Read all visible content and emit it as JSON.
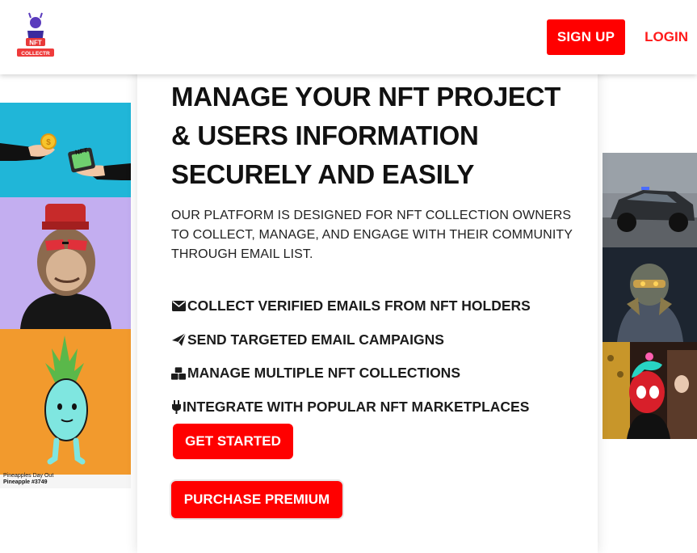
{
  "nav": {
    "logo_icon": "nft-collector-logo",
    "signup_label": "SIGN UP",
    "login_label": "LOGIN"
  },
  "hero": {
    "headline": "MANAGE YOUR NFT PROJECT & USERS INFORMATION SECURELY AND EASILY",
    "lede": "OUR PLATFORM IS DESIGNED FOR NFT COLLECTION OWNERS TO COLLECT, MANAGE, AND ENGAGE WITH THEIR COMMUNITY THROUGH EMAIL LIST."
  },
  "features": [
    {
      "icon": "envelope-icon",
      "label": "COLLECT VERIFIED EMAILS FROM NFT HOLDERS"
    },
    {
      "icon": "paper-plane-icon",
      "label": "SEND TARGETED EMAIL CAMPAIGNS"
    },
    {
      "icon": "cubes-icon",
      "label": "MANAGE MULTIPLE NFT COLLECTIONS"
    },
    {
      "icon": "plug-icon",
      "label": "INTEGRATE WITH POPULAR NFT MARKETPLACES"
    }
  ],
  "buttons": {
    "get_started": "GET STARTED",
    "purchase_premium": "PURCHASE PREMIUM"
  },
  "gallery_left": [
    {
      "name": "hands-coin-nft-art"
    },
    {
      "name": "ape-with-fez-art"
    },
    {
      "name": "pineapple-character-art",
      "caption_line1": "Pineapples Day Out",
      "caption_line2": "Pineapple #3749"
    }
  ],
  "gallery_right": [
    {
      "name": "armored-car-art"
    },
    {
      "name": "robot-warrior-art"
    },
    {
      "name": "spider-punk-art"
    }
  ],
  "colors": {
    "accent": "#ff0000",
    "login_text": "#ff1a1a",
    "background": "#ffffff"
  }
}
